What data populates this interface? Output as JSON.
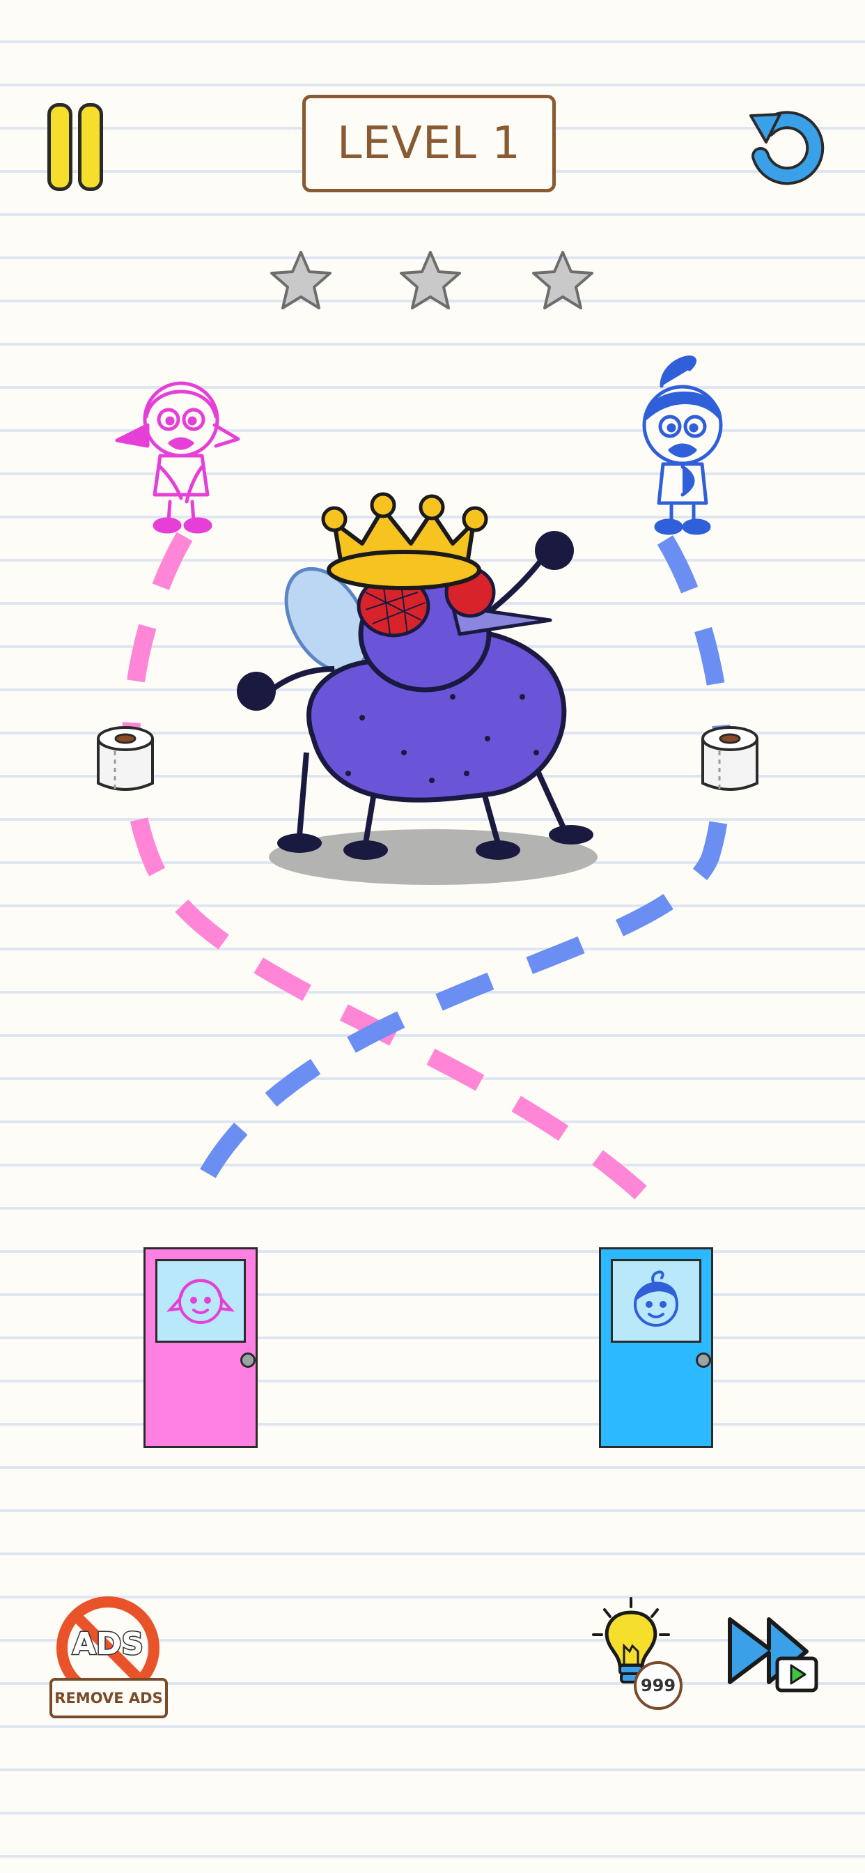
{
  "header": {
    "level_label": "LEVEL 1",
    "pause_icon": "pause-icon",
    "restart_icon": "undo-arrow-icon"
  },
  "stars": {
    "earned": 0,
    "total": 3,
    "icon": "star-icon"
  },
  "scene": {
    "characters": [
      {
        "name": "girl",
        "color": "#e63fd8"
      },
      {
        "name": "boy",
        "color": "#2f5fd9"
      }
    ],
    "paths": [
      {
        "for": "girl",
        "color": "#ff86d6"
      },
      {
        "for": "boy",
        "color": "#6a8ef2"
      }
    ],
    "items": [
      "toilet-paper-icon",
      "toilet-paper-icon"
    ],
    "enemy": "king-fly-monster",
    "doors": [
      {
        "name": "girl-door",
        "color": "#ff80e3"
      },
      {
        "name": "boy-door",
        "color": "#2cb9ff"
      }
    ]
  },
  "bottom": {
    "ads_badge": "ADS",
    "remove_ads_label": "REMOVE ADS",
    "hint_count": "999",
    "hint_icon": "lightbulb-icon",
    "skip_icon": "skip-video-icon"
  }
}
